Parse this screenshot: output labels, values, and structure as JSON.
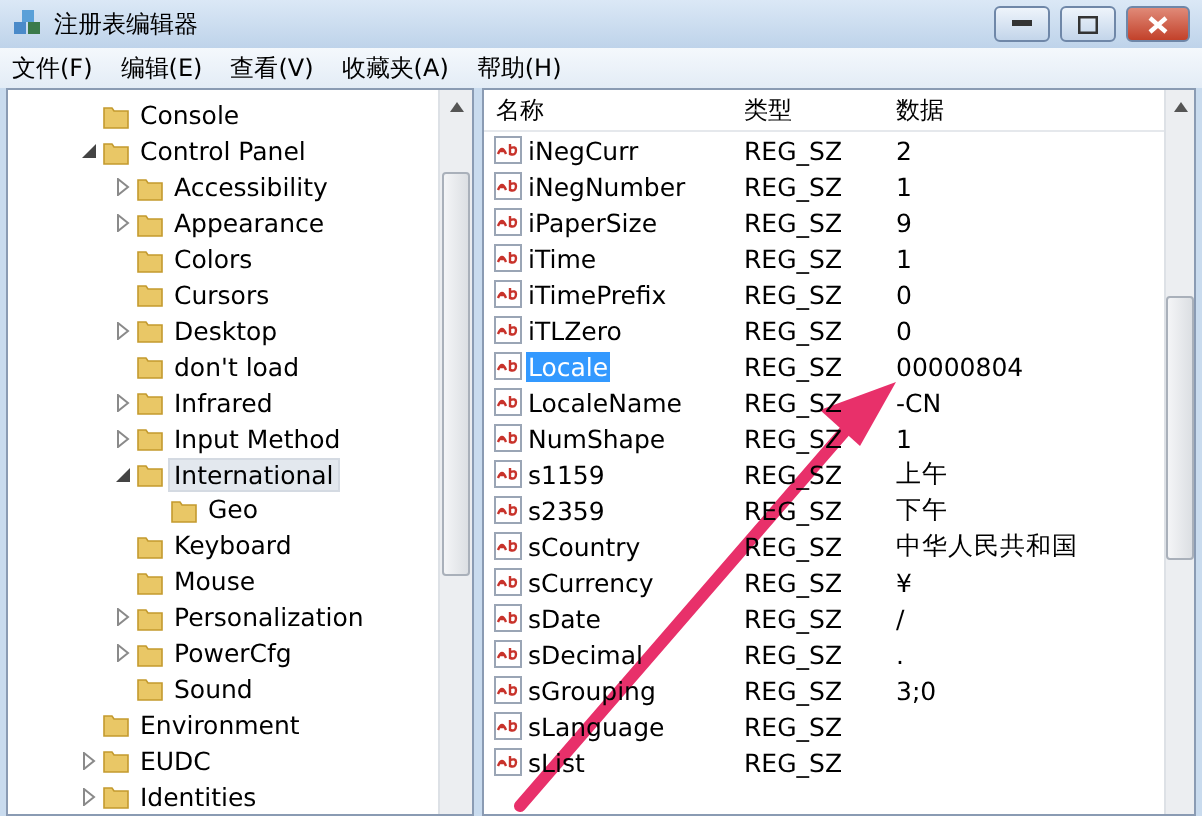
{
  "window": {
    "title": "注册表编辑器"
  },
  "menu": [
    "文件(F)",
    "编辑(E)",
    "查看(V)",
    "收藏夹(A)",
    "帮助(H)"
  ],
  "tree": [
    {
      "label": "Console",
      "selected": false
    },
    {
      "label": "Control Panel",
      "expanded": true,
      "selected": false,
      "children": [
        {
          "label": "Accessibility",
          "expanded": false,
          "selected": false
        },
        {
          "label": "Appearance",
          "expanded": false,
          "selected": false
        },
        {
          "label": "Colors",
          "selected": false
        },
        {
          "label": "Cursors",
          "selected": false
        },
        {
          "label": "Desktop",
          "expanded": false,
          "selected": false
        },
        {
          "label": "don't load",
          "selected": false
        },
        {
          "label": "Infrared",
          "expanded": false,
          "selected": false
        },
        {
          "label": "Input Method",
          "expanded": false,
          "selected": false
        },
        {
          "label": "International",
          "expanded": true,
          "selected": true,
          "children": [
            {
              "label": "Geo",
              "selected": false
            }
          ]
        },
        {
          "label": "Keyboard",
          "selected": false
        },
        {
          "label": "Mouse",
          "selected": false
        },
        {
          "label": "Personalization",
          "expanded": false,
          "selected": false
        },
        {
          "label": "PowerCfg",
          "expanded": false,
          "selected": false
        },
        {
          "label": "Sound",
          "selected": false
        }
      ]
    },
    {
      "label": "Environment",
      "selected": false
    },
    {
      "label": "EUDC",
      "expanded": false,
      "selected": false
    },
    {
      "label": "Identities",
      "expanded": false,
      "selected": false
    }
  ],
  "table": {
    "columns": [
      "名称",
      "类型",
      "数据"
    ],
    "rows": [
      {
        "name": "iNegCurr",
        "type": "REG_SZ",
        "data": "2",
        "selected": false
      },
      {
        "name": "iNegNumber",
        "type": "REG_SZ",
        "data": "1",
        "selected": false
      },
      {
        "name": "iPaperSize",
        "type": "REG_SZ",
        "data": "9",
        "selected": false
      },
      {
        "name": "iTime",
        "type": "REG_SZ",
        "data": "1",
        "selected": false
      },
      {
        "name": "iTimePrefix",
        "type": "REG_SZ",
        "data": "0",
        "selected": false
      },
      {
        "name": "iTLZero",
        "type": "REG_SZ",
        "data": "0",
        "selected": false
      },
      {
        "name": "Locale",
        "type": "REG_SZ",
        "data": "00000804",
        "selected": true
      },
      {
        "name": "LocaleName",
        "type": "REG_SZ",
        "data": "-CN",
        "selected": false
      },
      {
        "name": "NumShape",
        "type": "REG_SZ",
        "data": "1",
        "selected": false
      },
      {
        "name": "s1159",
        "type": "REG_SZ",
        "data": "上午",
        "selected": false
      },
      {
        "name": "s2359",
        "type": "REG_SZ",
        "data": "下午",
        "selected": false
      },
      {
        "name": "sCountry",
        "type": "REG_SZ",
        "data": "中华人民共和国",
        "selected": false
      },
      {
        "name": "sCurrency",
        "type": "REG_SZ",
        "data": "¥",
        "selected": false
      },
      {
        "name": "sDate",
        "type": "REG_SZ",
        "data": "/",
        "selected": false
      },
      {
        "name": "sDecimal",
        "type": "REG_SZ",
        "data": ".",
        "selected": false
      },
      {
        "name": "sGrouping",
        "type": "REG_SZ",
        "data": "3;0",
        "selected": false
      },
      {
        "name": "sLanguage",
        "type": "REG_SZ",
        "selected": false
      },
      {
        "name": "sList",
        "type": "REG_SZ",
        "selected": false
      }
    ]
  }
}
